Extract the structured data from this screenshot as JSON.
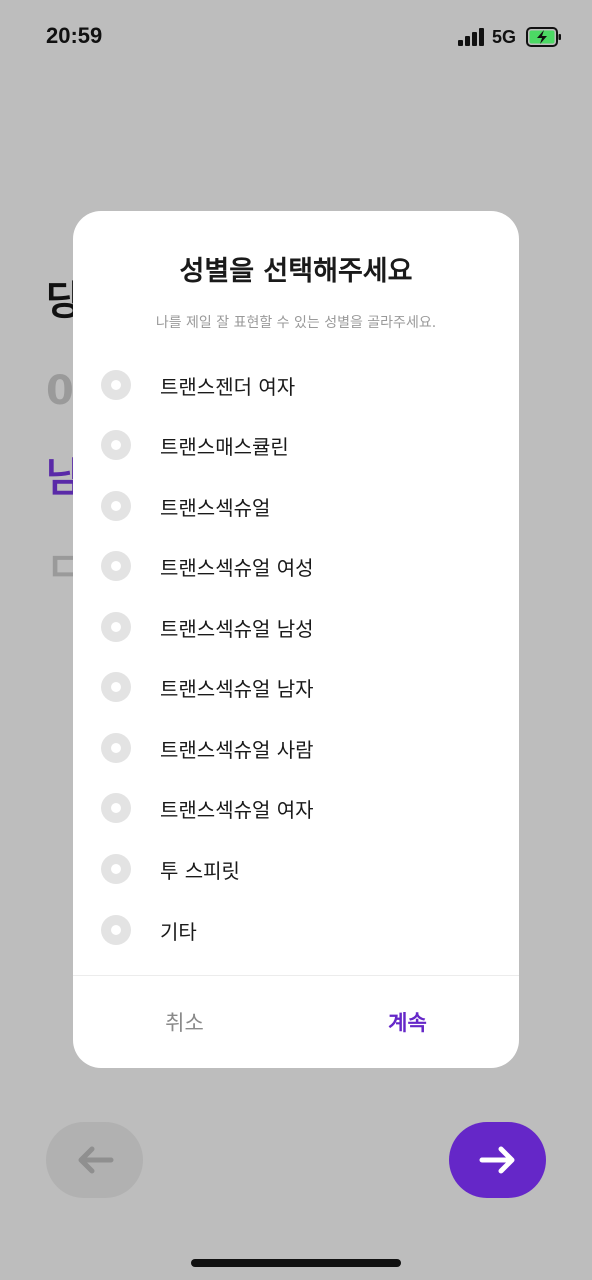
{
  "status_bar": {
    "time": "20:59",
    "network": "5G",
    "icons": [
      "signal-icon",
      "battery-charging-icon"
    ]
  },
  "background": {
    "heading": "당",
    "field_value": "0",
    "selected_option": "남",
    "other_option": "ㄷ"
  },
  "modal": {
    "title": "성별을 선택해주세요",
    "subtitle": "나를 제일 잘 표현할 수 있는 성별을 골라주세요.",
    "options": [
      {
        "label": "트랜스젠더 여자"
      },
      {
        "label": "트랜스매스큘린"
      },
      {
        "label": "트랜스섹슈얼"
      },
      {
        "label": "트랜스섹슈얼 여성"
      },
      {
        "label": "트랜스섹슈얼 남성"
      },
      {
        "label": "트랜스섹슈얼 남자"
      },
      {
        "label": "트랜스섹슈얼 사람"
      },
      {
        "label": "트랜스섹슈얼 여자"
      },
      {
        "label": "투 스피릿"
      },
      {
        "label": "기타"
      }
    ],
    "cancel_label": "취소",
    "continue_label": "계속"
  },
  "navigation": {
    "back_icon": "arrow-left-icon",
    "next_icon": "arrow-right-icon"
  },
  "colors": {
    "accent": "#6527c8",
    "overlay_background": "#bdbdbd",
    "radio_unselected": "#e3e3e3",
    "battery_charging": "#4cd964"
  }
}
